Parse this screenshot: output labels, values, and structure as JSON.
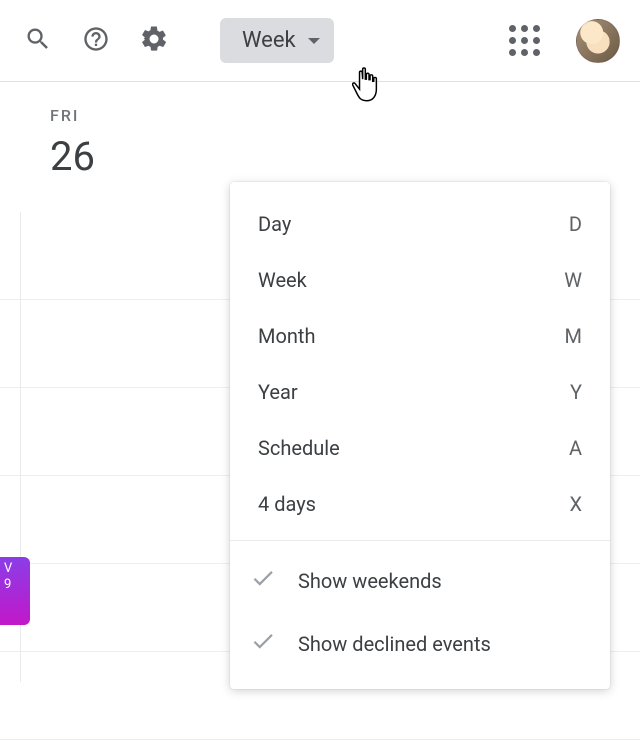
{
  "toolbar": {
    "view_label": "Week"
  },
  "day_header": {
    "name": "FRI",
    "number": "26"
  },
  "event": {
    "title_fragment": "V",
    "time_fragment": "9"
  },
  "menu": {
    "items": [
      {
        "label": "Day",
        "shortcut": "D"
      },
      {
        "label": "Week",
        "shortcut": "W"
      },
      {
        "label": "Month",
        "shortcut": "M"
      },
      {
        "label": "Year",
        "shortcut": "Y"
      },
      {
        "label": "Schedule",
        "shortcut": "A"
      },
      {
        "label": "4 days",
        "shortcut": "X"
      }
    ],
    "toggles": [
      {
        "label": "Show weekends",
        "checked": true
      },
      {
        "label": "Show declined events",
        "checked": true
      }
    ]
  }
}
